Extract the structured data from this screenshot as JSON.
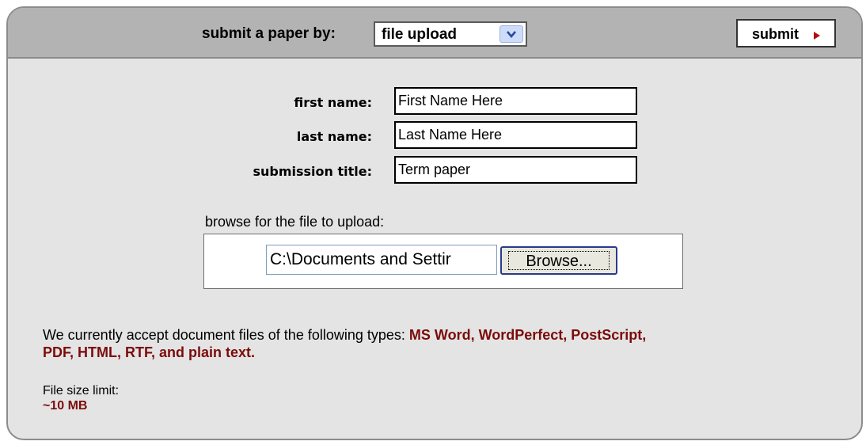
{
  "header": {
    "submit_by_label": "submit a paper by:",
    "method_select": {
      "value": "file upload"
    },
    "submit_label": "submit"
  },
  "form": {
    "first_name": {
      "label": "first name:",
      "value": "First Name Here"
    },
    "last_name": {
      "label": "last name:",
      "value": "Last Name Here"
    },
    "submission_title": {
      "label": "submission title:",
      "value": "Term paper"
    }
  },
  "upload": {
    "label": "browse for the file to upload:",
    "path_value": "C:\\Documents and Settir",
    "browse_label": "Browse..."
  },
  "info": {
    "accept_prefix": "We currently accept document files of the following types: ",
    "accept_types_line1": "MS Word, WordPerfect, PostScript,",
    "accept_types_line2": "PDF, HTML, RTF, and plain text.",
    "size_label": "File size limit:",
    "size_value": "~10 MB"
  },
  "colors": {
    "header_bg": "#b3b3b3",
    "panel_bg": "#e4e4e4",
    "accent": "#7b0b0b"
  },
  "icons": {
    "select_arrow": "chevron-down-icon",
    "submit_arrow": "caret-right-icon"
  }
}
